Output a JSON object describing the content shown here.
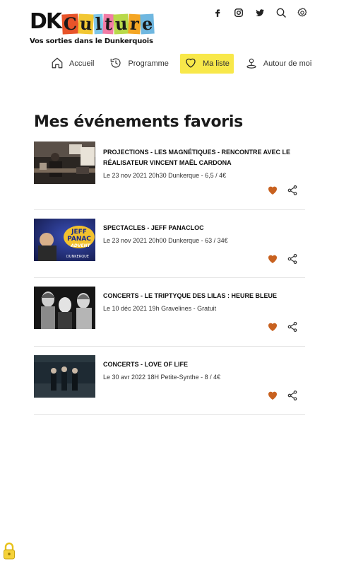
{
  "header": {
    "logo": {
      "part1": "DK",
      "part2_letters": [
        "C",
        "u",
        "l",
        "t",
        "u",
        "r",
        "e"
      ],
      "letter_colors": [
        "#e8542a",
        "#f2c733",
        "#7fc7e8",
        "#f27ca6",
        "#b8d94a",
        "#f5a623",
        "#6fb7e0"
      ],
      "tagline": "Vos sorties dans le Dunkerquois"
    },
    "social_icons": [
      "facebook-icon",
      "instagram-icon",
      "twitter-icon",
      "search-icon",
      "settings-icon"
    ]
  },
  "nav": {
    "items": [
      {
        "label": "Accueil",
        "icon": "home-icon",
        "active": false
      },
      {
        "label": "Programme",
        "icon": "history-icon",
        "active": false
      },
      {
        "label": "Ma liste",
        "icon": "heart-icon",
        "active": true
      },
      {
        "label": "Autour de moi",
        "icon": "location-icon",
        "active": false
      }
    ],
    "active_color": "#f8e84a"
  },
  "main": {
    "title": "Mes événements favoris",
    "events": [
      {
        "title": "PROJECTIONS - LES MAGNÉTIQUES - RENCONTRE AVEC LE RÉALISATEUR VINCENT MAËL CARDONA",
        "meta": "Le 23 nov 2021 20h30 Dunkerque - 6,5 / 4€",
        "thumb": "projection-photo"
      },
      {
        "title": "SPECTACLES - JEFF PANACLOC",
        "meta": "Le 23 nov 2021 20h00 Dunkerque - 63 / 34€",
        "thumb": "spectacle-poster",
        "thumb_text": [
          "JEFF",
          "PANAC",
          "ADVENT",
          "DUNKERQUE"
        ]
      },
      {
        "title": "CONCERTS - LE TRIPTYQUE DES LILAS : HEURE BLEUE",
        "meta": "Le 10 déc 2021 19h Gravelines - Gratuit",
        "thumb": "concert-bw-photo"
      },
      {
        "title": "CONCERTS - LOVE OF LIFE",
        "meta": "Le 30 avr 2022 18H Petite-Synthe - 8 / 4€",
        "thumb": "band-photo"
      }
    ],
    "heart_color": "#c8611f",
    "icon_color": "#c8611f"
  }
}
